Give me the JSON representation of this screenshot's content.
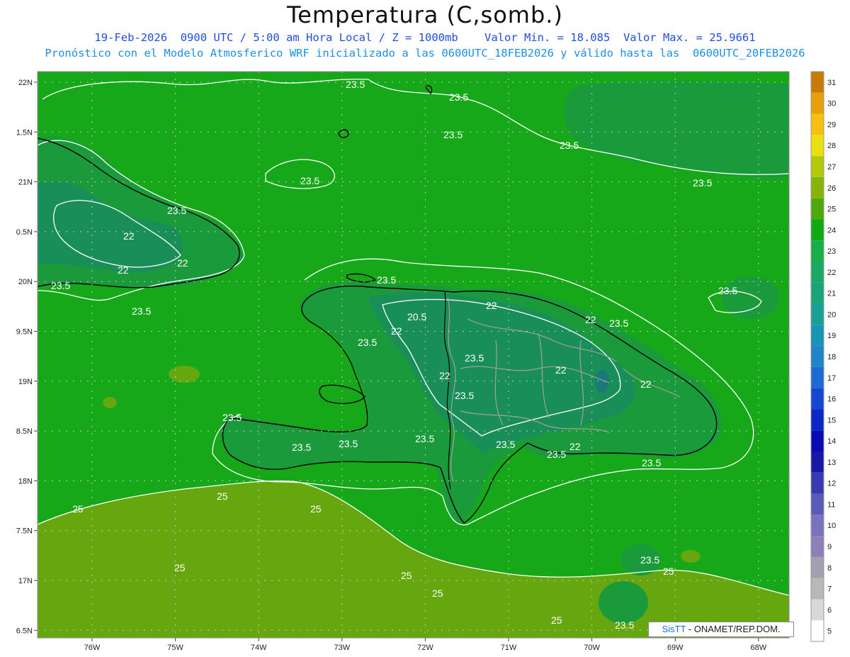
{
  "title": "Temperatura (C,somb.)",
  "subtitle_line1": "19-Feb-2026  0900 UTC / 5:00 am Hora Local / Z = 1000mb    Valor Min. = 18.085  Valor Max. = 25.9661",
  "subtitle_line2": "Pronóstico con el Modelo Atmosferico WRF inicializado a las 0600UTC_18FEB2026 y válido hasta las  0600UTC_20FEB2026",
  "credit": {
    "logo": "SisTT",
    "text": " - ONAMET/REP.DOM."
  },
  "lat_labels": [
    "22N",
    "1.5N",
    "21N",
    "0.5N",
    "20N",
    "9.5N",
    "19N",
    "8.5N",
    "18N",
    "7.5N",
    "17N",
    "6.5N"
  ],
  "lon_labels": [
    "76W",
    "75W",
    "74W",
    "73W",
    "72W",
    "71W",
    "70W",
    "69W",
    "68W"
  ],
  "contour_labels": [
    "23.5",
    "22",
    "20.5",
    "25"
  ],
  "colorbar": {
    "levels": [
      5,
      6,
      7,
      8,
      9,
      10,
      11,
      12,
      13,
      14,
      15,
      16,
      17,
      18,
      19,
      20,
      21,
      22,
      23,
      24,
      25,
      26,
      27,
      28,
      29,
      30,
      31
    ],
    "colors": [
      "#ffffff",
      "#d8d8d8",
      "#b8b8b8",
      "#a0a0b0",
      "#8e7fb6",
      "#7a72bc",
      "#5a5ab8",
      "#3a3ab0",
      "#1818a8",
      "#0a0ab4",
      "#0a28c8",
      "#1448d4",
      "#1e6ad4",
      "#1e86c8",
      "#1a96b4",
      "#18a096",
      "#1aa47a",
      "#1aa864",
      "#1aae4a",
      "#12aa14",
      "#4ea80e",
      "#86b40a",
      "#b4c80a",
      "#e8e010",
      "#f6c010",
      "#e8a00a",
      "#c87a06"
    ]
  },
  "field_colors": {
    "sea": "#16a818",
    "land_high": "#1b9a3c",
    "land_cool": "#1a8e58",
    "south_warm": "#66a60e",
    "contour": "#ffffff",
    "coast": "#000000",
    "border": "#a0a0a0"
  }
}
